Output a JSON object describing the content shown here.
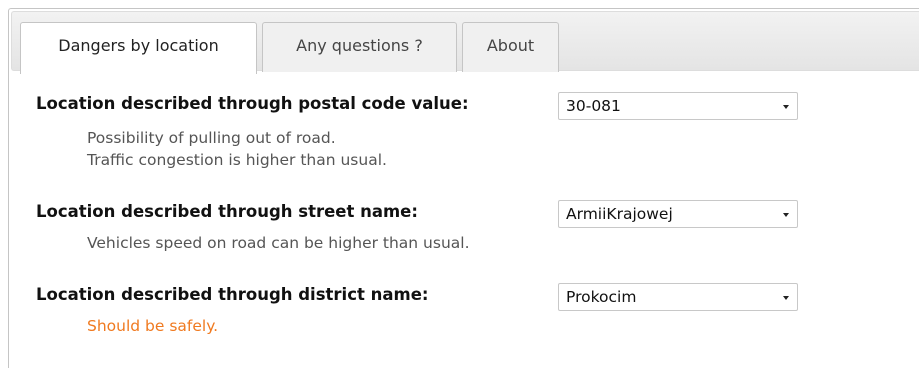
{
  "tabs": [
    {
      "label": "Dangers by location",
      "active": true
    },
    {
      "label": "Any questions ?",
      "active": false
    },
    {
      "label": "About",
      "active": false
    }
  ],
  "locations": [
    {
      "label": "Location described through postal code value:",
      "selected": "30-081",
      "messages": [
        "Possibility of pulling out of road.",
        "Traffic congestion is higher than usual."
      ]
    },
    {
      "label": "Location described through street name:",
      "selected": "ArmiiKrajowej",
      "messages": [
        "Vehicles speed on road can be higher than usual."
      ]
    },
    {
      "label": "Location described through district name:",
      "selected": "Prokocim",
      "messages": [
        "Should be safely."
      ]
    }
  ],
  "colors": {
    "safe_message": "#f07a20",
    "danger_message": "#555555"
  }
}
